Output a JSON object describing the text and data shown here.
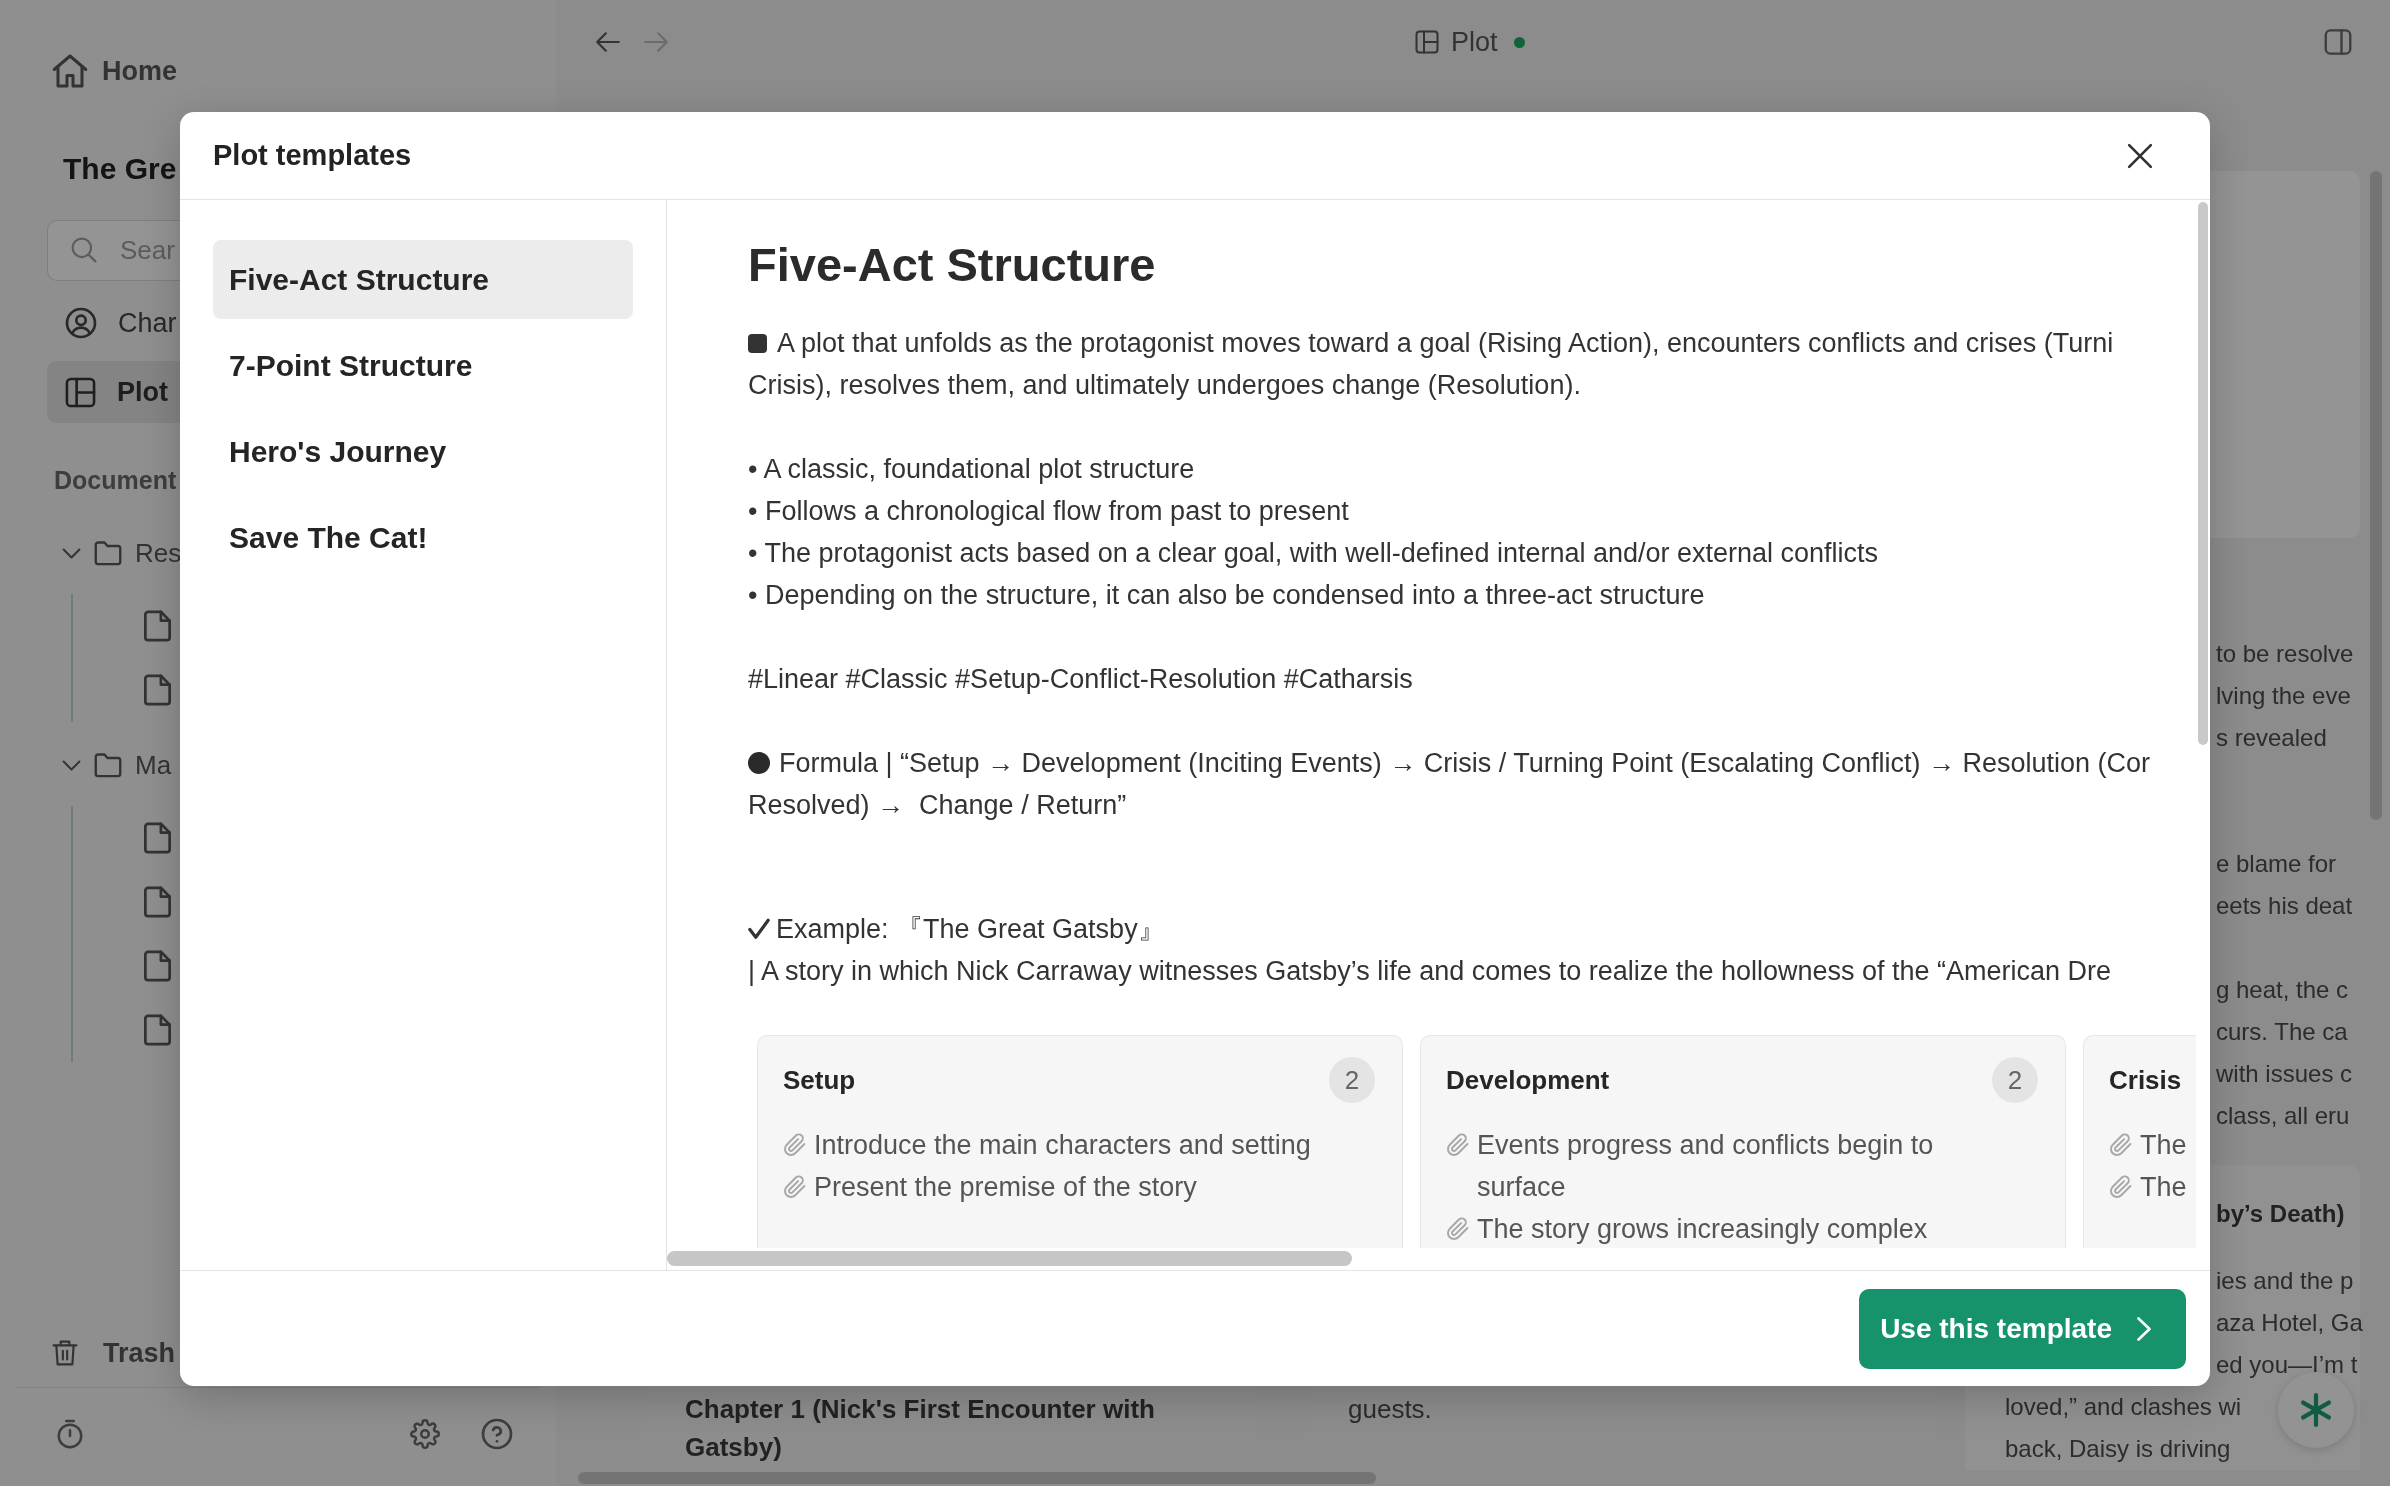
{
  "sidebar": {
    "home": "Home",
    "project_title": "The Gre",
    "search": {
      "placeholder": "Sear"
    },
    "nav": [
      {
        "kind": "person",
        "label": "Char",
        "selected": false
      },
      {
        "kind": "board",
        "label": "Plot",
        "selected": true
      }
    ],
    "section": "Document",
    "folders": [
      {
        "label": "Res",
        "expanded": true,
        "children": [
          {
            "kind": "file"
          },
          {
            "kind": "file"
          }
        ]
      },
      {
        "label": "Ma",
        "expanded": true,
        "children": [
          {
            "kind": "file"
          },
          {
            "kind": "file"
          },
          {
            "kind": "file"
          },
          {
            "kind": "file"
          }
        ]
      }
    ],
    "trash": "Trash"
  },
  "topbar": {
    "nav": [
      {
        "kind": "back",
        "disabled": false
      },
      {
        "kind": "forward",
        "disabled": true
      }
    ],
    "title": "Plot",
    "synced": true
  },
  "board": {
    "column_1": {
      "card_title": [
        "Chapter 1 (Nick's First Encounter with",
        "Gatsby)"
      ]
    },
    "column_2": {
      "card_text": "guests."
    },
    "column_3": {
      "paragraphs": [
        [
          "to be resolve",
          "lving the eve",
          "s revealed"
        ],
        [
          "e blame for",
          "eets his deat"
        ],
        [
          "g heat, the c",
          "curs. The ca",
          "with issues c",
          "class, all eru"
        ]
      ],
      "card": {
        "title": "by’s Death)",
        "text_fragments": [
          [
            "ies and the p",
            "aza Hotel, Ga",
            "ed you—I’m t"
          ],
          [
            "loved,” and clashes wi",
            "back, Daisy is driving"
          ]
        ]
      }
    }
  },
  "modal": {
    "title": "Plot templates",
    "templates": [
      {
        "label": "Five-Act Structure",
        "selected": true
      },
      {
        "label": "7-Point Structure",
        "selected": false
      },
      {
        "label": "Hero's Journey",
        "selected": false
      },
      {
        "label": "Save The Cat!",
        "selected": false
      }
    ],
    "detail": {
      "heading": "Five-Act Structure",
      "blocks": [
        {
          "kind": "summary",
          "lines": [
            "A plot that unfolds as the protagonist moves toward a goal (Rising Action), encounters conflicts and crises (Turni",
            "Crisis), resolves them, and ultimately undergoes change (Resolution)."
          ]
        },
        {
          "kind": "bullets",
          "items": [
            "• A classic, foundational plot structure",
            "• Follows a chronological flow from past to present",
            "• The protagonist acts based on a clear goal, with well-defined internal and/or external conflicts",
            "• Depending on the structure, it can also be condensed into a three-act structure"
          ]
        },
        {
          "kind": "tags",
          "text": "#Linear #Classic #Setup-Conflict-Resolution #Catharsis"
        },
        {
          "kind": "formula",
          "lines": [
            "Formula | “Setup → Development (Inciting Events) → Crisis / Turning Point (Escalating Conflict) → Resolution (Cor",
            "Resolved) →  Change / Return”"
          ]
        },
        {
          "kind": "example",
          "title": "Example: 『The Great Gatsby』",
          "text": "| A story in which Nick Carraway witnesses Gatsby’s life and comes to realize the hollowness of the “American Dre"
        }
      ],
      "stages": [
        {
          "title": "Setup",
          "count": "2",
          "notes": [
            "Introduce the main characters and setting",
            "Present the premise of the story"
          ]
        },
        {
          "title": "Development",
          "count": "2",
          "notes": [
            "Events progress and conflicts begin to surface",
            "The story grows increasingly complex"
          ]
        },
        {
          "title": "Crisis",
          "notes": [
            "The",
            "The"
          ]
        }
      ]
    },
    "action": "Use this template"
  }
}
